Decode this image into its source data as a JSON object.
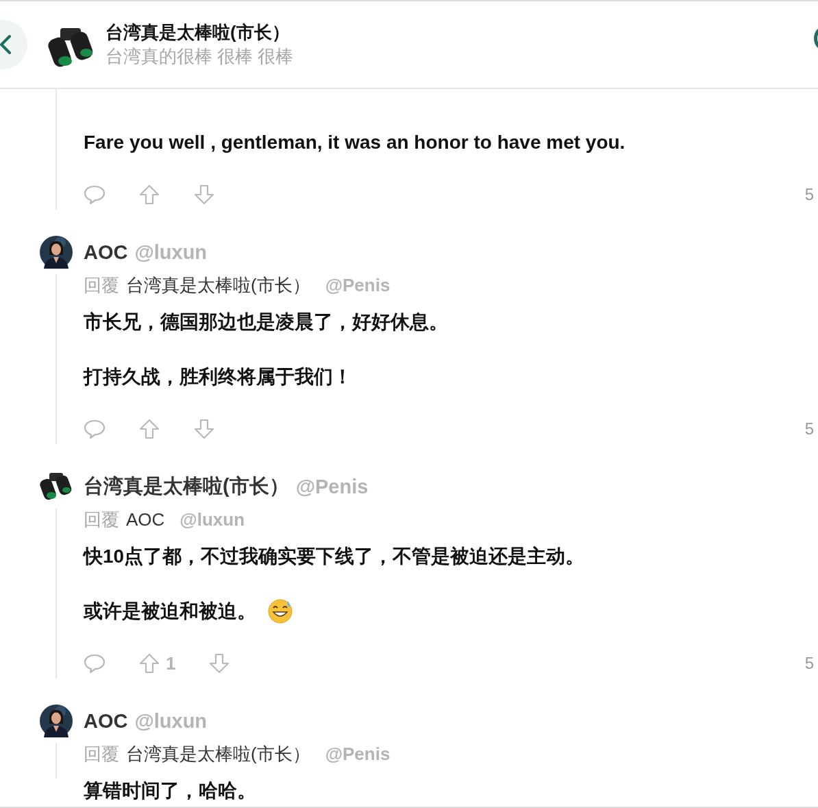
{
  "header": {
    "title": "台湾真是太棒啦(市长）",
    "subtitle": "台湾真的很棒 很棒 很棒"
  },
  "comments": [
    {
      "paragraphs": [
        {
          "text": "Fare you well , gentleman, it was an honor to have met you."
        }
      ],
      "count": "5"
    },
    {
      "avatar": {
        "kind": "picture"
      },
      "author": "AOC",
      "handle": "@luxun",
      "reply_label": "回覆",
      "reply_name": "台湾真是太棒啦(市长）",
      "reply_handle": "@Penis",
      "paragraphs": [
        {
          "text": "市长兄，德国那边也是凌晨了，好好休息。"
        },
        {
          "text": "打持久战，胜利终将属于我们！"
        }
      ],
      "count": "5"
    },
    {
      "avatar": {
        "kind": "icon"
      },
      "author": "台湾真是太棒啦(市长）",
      "handle": "@Penis",
      "reply_label": "回覆",
      "reply_name": "AOC",
      "reply_handle": "@luxun",
      "paragraphs": [
        {
          "text": "快10点了都，不过我确实要下线了，不管是被迫还是主动。"
        },
        {
          "text": "或许是被迫和被迫。",
          "emoji": true
        }
      ],
      "upvotes": "1",
      "count": "5"
    },
    {
      "avatar": {
        "kind": "picture"
      },
      "author": "AOC",
      "handle": "@luxun",
      "reply_label": "回覆",
      "reply_name": "台湾真是太棒啦(市长）",
      "reply_handle": "@Penis",
      "paragraphs": [
        {
          "text": "算错时间了，哈哈。"
        }
      ]
    }
  ]
}
